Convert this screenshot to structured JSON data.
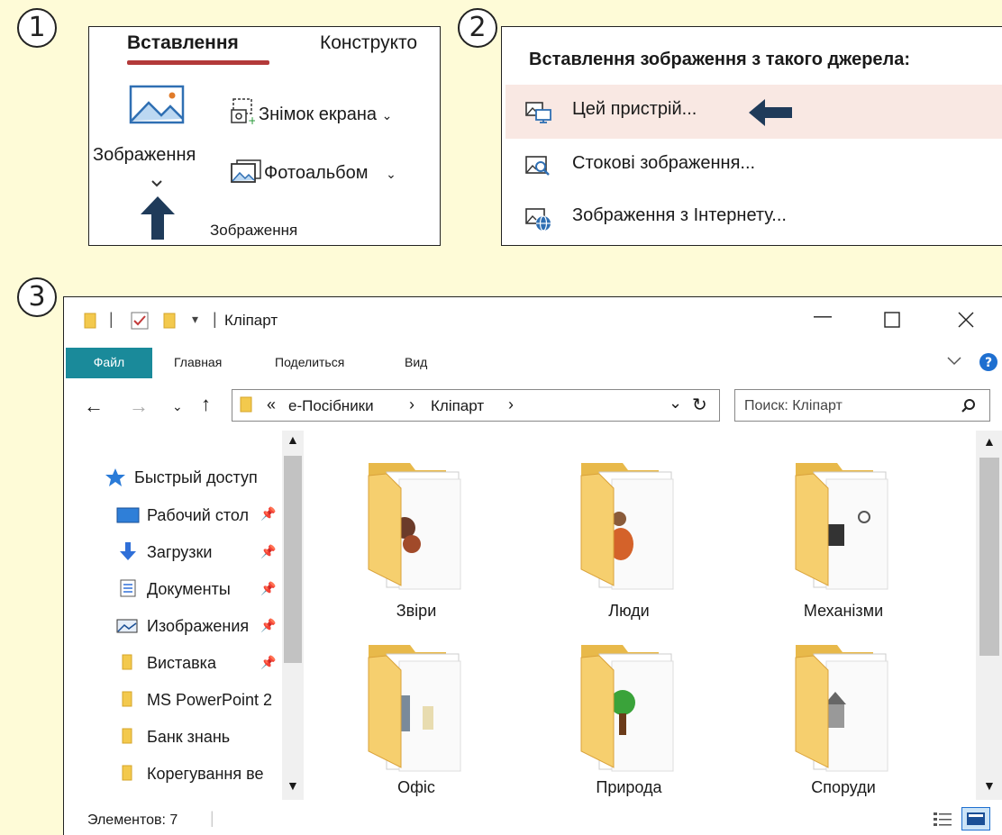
{
  "steps": [
    "1",
    "2",
    "3"
  ],
  "panel1": {
    "tab_active": "Вставлення",
    "tab_other": "Конструкто",
    "pictures_label": "Зображення",
    "screenshot_label": "Знімок екрана",
    "photoalbum_label": "Фотоальбом",
    "group_label": "Зображення",
    "accent_color": "#b33a3a",
    "arrow_color": "#1f3b5a"
  },
  "panel2": {
    "header": "Вставлення зображення з такого джерела:",
    "items": [
      {
        "label": "Цей пристрій...",
        "icon": "this-device-icon",
        "highlighted": true
      },
      {
        "label": "Стокові зображення...",
        "icon": "stock-images-icon",
        "highlighted": false
      },
      {
        "label": "Зображення з Інтернету...",
        "icon": "online-pictures-icon",
        "highlighted": false
      }
    ],
    "highlight_color": "#f9e8e3"
  },
  "explorer": {
    "title": "Кліпарт",
    "ribbon_tabs": [
      "Файл",
      "Главная",
      "Поделиться",
      "Вид"
    ],
    "file_tab_color": "#1a8a9a",
    "breadcrumb": {
      "overflow": "«",
      "parts": [
        "e-Посібники",
        "Кліпарт"
      ],
      "separator": "›"
    },
    "search_placeholder": "Поиск: Кліпарт",
    "nav": [
      {
        "label": "Быстрый доступ",
        "icon": "star-icon"
      },
      {
        "label": "Рабочий стол",
        "icon": "desktop-icon",
        "pinned": true
      },
      {
        "label": "Загрузки",
        "icon": "download-icon",
        "pinned": true
      },
      {
        "label": "Документы",
        "icon": "documents-icon",
        "pinned": true
      },
      {
        "label": "Изображения",
        "icon": "pictures-icon",
        "pinned": true
      },
      {
        "label": "Виставка",
        "icon": "folder-icon",
        "pinned": true
      },
      {
        "label": "MS PowerPoint 2",
        "icon": "folder-icon"
      },
      {
        "label": "Банк знань",
        "icon": "folder-icon"
      },
      {
        "label": "Корегування ве",
        "icon": "folder-icon"
      }
    ],
    "folders": [
      {
        "label": "Звіри",
        "icon": "animals-clipart-icon"
      },
      {
        "label": "Люди",
        "icon": "people-clipart-icon"
      },
      {
        "label": "Механізми",
        "icon": "machines-clipart-icon"
      },
      {
        "label": "Офіс",
        "icon": "office-clipart-icon"
      },
      {
        "label": "Природа",
        "icon": "nature-clipart-icon"
      },
      {
        "label": "Споруди",
        "icon": "buildings-clipart-icon"
      }
    ],
    "status": "Элементов: 7"
  }
}
